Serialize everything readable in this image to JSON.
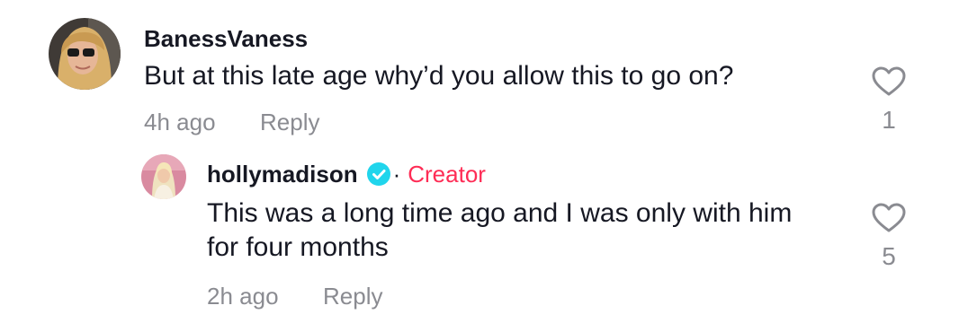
{
  "comments": [
    {
      "username": "BanessVaness",
      "text": "But at this late age why’d you allow this to go on?",
      "timestamp": "4h ago",
      "reply_label": "Reply",
      "like_count": "1",
      "like_icon": "heart-outline-icon"
    }
  ],
  "replies": [
    {
      "username": "hollymadison",
      "verified_icon": "verified-check-icon",
      "separator": "·",
      "badge": "Creator",
      "text": "This was a long time ago and I was only with him for four months",
      "timestamp": "2h ago",
      "reply_label": "Reply",
      "like_count": "5",
      "like_icon": "heart-outline-icon"
    }
  ],
  "colors": {
    "text_primary": "#161823",
    "text_secondary": "#8a8b91",
    "creator_badge": "#fe2c55",
    "verified": "#20d5ec"
  }
}
